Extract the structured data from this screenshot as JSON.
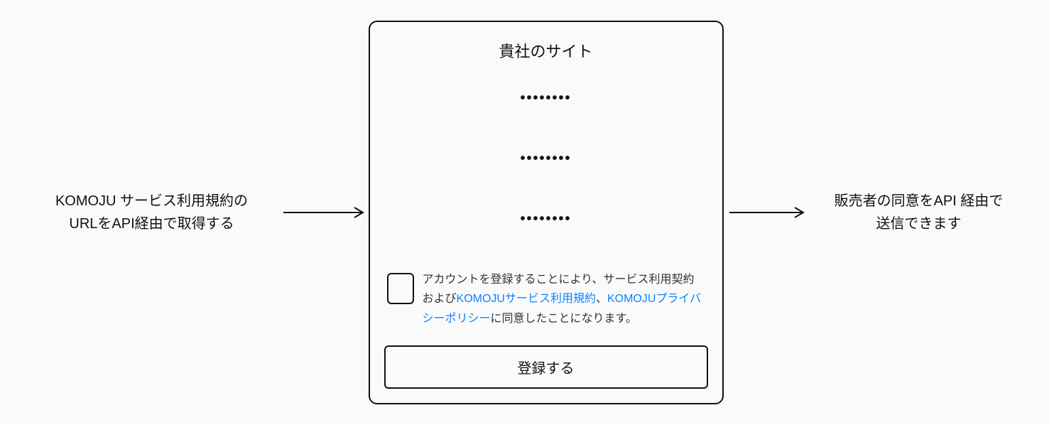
{
  "left": {
    "line1": "KOMOJU サービス利用規約の",
    "line2": "URLをAPI経由で取得する"
  },
  "right": {
    "line1": "販売者の同意をAPI 経由で",
    "line2": "送信できます"
  },
  "card": {
    "title": "貴社のサイト",
    "placeholder_rows": [
      "••••••••",
      "••••••••",
      "••••••••"
    ],
    "consent": {
      "text_before": "アカウントを登録することにより、サービス利用契約および",
      "link1": "KOMOJUサービス利用規約",
      "separator": "、",
      "link2": "KOMOJUプライバシーポリシー",
      "text_after": "に同意したことになります。"
    },
    "button_label": "登録する"
  }
}
